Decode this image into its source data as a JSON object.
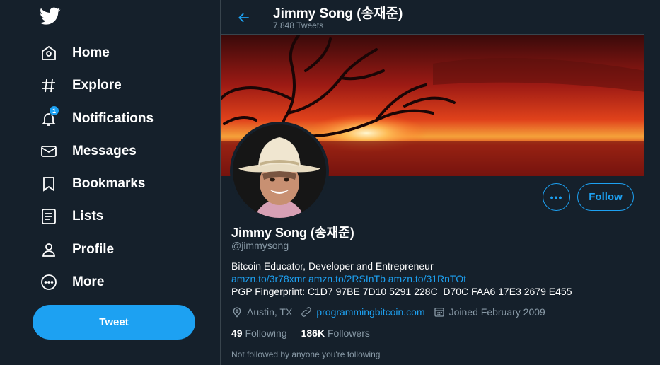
{
  "sidebar": {
    "logo_icon": "twitter-bird-icon",
    "items": [
      {
        "label": "Home",
        "icon": "home-icon"
      },
      {
        "label": "Explore",
        "icon": "hashtag-icon"
      },
      {
        "label": "Notifications",
        "icon": "bell-icon",
        "badge": "1"
      },
      {
        "label": "Messages",
        "icon": "envelope-icon"
      },
      {
        "label": "Bookmarks",
        "icon": "bookmark-icon"
      },
      {
        "label": "Lists",
        "icon": "list-icon"
      },
      {
        "label": "Profile",
        "icon": "person-icon"
      },
      {
        "label": "More",
        "icon": "more-circle-icon"
      }
    ],
    "tweet_label": "Tweet"
  },
  "header": {
    "title": "Jimmy Song (송재준)",
    "subtitle": "7,848 Tweets"
  },
  "profile": {
    "more_label": "•••",
    "follow_label": "Follow",
    "name": "Jimmy Song (송재준)",
    "handle": "@jimmysong",
    "bio_line1": "Bitcoin Educator, Developer and Entrepreneur",
    "bio_links": [
      "amzn.to/3r78xmr",
      "amzn.to/2RSInTb",
      "amzn.to/31RnTOt"
    ],
    "bio_line3": "PGP Fingerprint: C1D7 97BE 7D10 5291 228C  D70C FAA6 17E3 2679 E455",
    "location": "Austin, TX",
    "website": "programmingbitcoin.com",
    "joined": "Joined February 2009",
    "following_count": "49",
    "following_label": "Following",
    "followers_count": "186K",
    "followers_label": "Followers",
    "not_followed": "Not followed by anyone you're following"
  },
  "colors": {
    "background": "#15202b",
    "accent": "#1da1f2",
    "muted": "#8899a6",
    "border": "#38444d"
  }
}
